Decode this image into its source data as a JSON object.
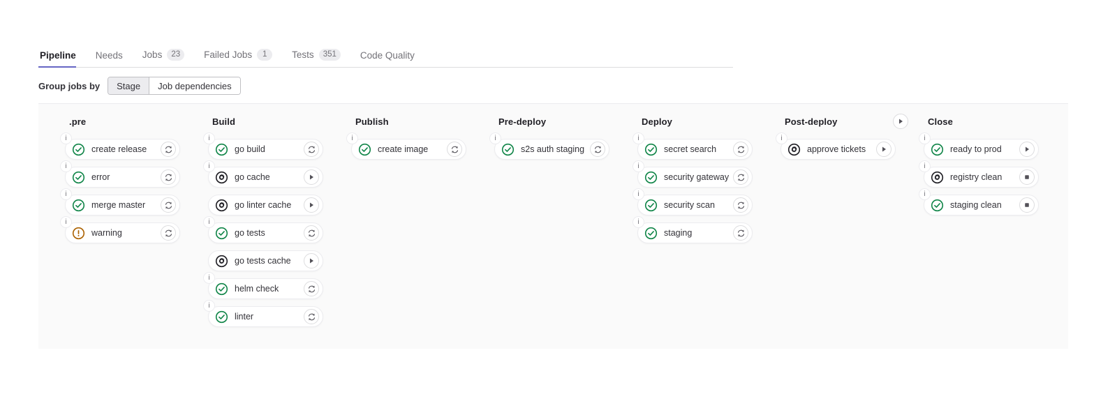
{
  "tabs": [
    {
      "label": "Pipeline",
      "badge": null,
      "active": true
    },
    {
      "label": "Needs",
      "badge": null,
      "active": false
    },
    {
      "label": "Jobs",
      "badge": "23",
      "active": false
    },
    {
      "label": "Failed Jobs",
      "badge": "1",
      "active": false
    },
    {
      "label": "Tests",
      "badge": "351",
      "active": false
    },
    {
      "label": "Code Quality",
      "badge": null,
      "active": false
    }
  ],
  "group_bar": {
    "label": "Group jobs by",
    "options": [
      {
        "label": "Stage",
        "selected": true
      },
      {
        "label": "Job dependencies",
        "selected": false
      }
    ]
  },
  "colors": {
    "accent": "#6666c4",
    "success": "#108548",
    "warning": "#ab6100",
    "manual": "#1f1e24",
    "panel_bg": "#fafafa",
    "card_border": "#ececef",
    "text": "#333238",
    "muted": "#737278"
  },
  "stages": [
    {
      "name": ".pre",
      "header_action": null,
      "jobs": [
        {
          "name": "create release",
          "status": "success",
          "status_icon": "check-circle-icon",
          "action": "retry",
          "action_icon": "retry-icon",
          "info": true
        },
        {
          "name": "error",
          "status": "success",
          "status_icon": "check-circle-icon",
          "action": "retry",
          "action_icon": "retry-icon",
          "info": true
        },
        {
          "name": "merge master",
          "status": "success",
          "status_icon": "check-circle-icon",
          "action": "retry",
          "action_icon": "retry-icon",
          "info": true
        },
        {
          "name": "warning",
          "status": "warning",
          "status_icon": "warning-icon",
          "action": "retry",
          "action_icon": "retry-icon",
          "info": true
        }
      ]
    },
    {
      "name": "Build",
      "header_action": null,
      "jobs": [
        {
          "name": "go build",
          "status": "success",
          "status_icon": "check-circle-icon",
          "action": "retry",
          "action_icon": "retry-icon",
          "info": true
        },
        {
          "name": "go cache",
          "status": "manual",
          "status_icon": "manual-gear-icon",
          "action": "play",
          "action_icon": "play-icon",
          "info": true
        },
        {
          "name": "go linter cache",
          "status": "manual",
          "status_icon": "manual-gear-icon",
          "action": "play",
          "action_icon": "play-icon",
          "info": false
        },
        {
          "name": "go tests",
          "status": "success",
          "status_icon": "check-circle-icon",
          "action": "retry",
          "action_icon": "retry-icon",
          "info": true
        },
        {
          "name": "go tests cache",
          "status": "manual",
          "status_icon": "manual-gear-icon",
          "action": "play",
          "action_icon": "play-icon",
          "info": false
        },
        {
          "name": "helm check",
          "status": "success",
          "status_icon": "check-circle-icon",
          "action": "retry",
          "action_icon": "retry-icon",
          "info": true
        },
        {
          "name": "linter",
          "status": "success",
          "status_icon": "check-circle-icon",
          "action": "retry",
          "action_icon": "retry-icon",
          "info": true
        }
      ]
    },
    {
      "name": "Publish",
      "header_action": null,
      "jobs": [
        {
          "name": "create image",
          "status": "success",
          "status_icon": "check-circle-icon",
          "action": "retry",
          "action_icon": "retry-icon",
          "info": true
        }
      ]
    },
    {
      "name": "Pre-deploy",
      "header_action": null,
      "jobs": [
        {
          "name": "s2s auth staging",
          "status": "success",
          "status_icon": "check-circle-icon",
          "action": "retry",
          "action_icon": "retry-icon",
          "info": true
        }
      ]
    },
    {
      "name": "Deploy",
      "header_action": null,
      "jobs": [
        {
          "name": "secret search",
          "status": "success",
          "status_icon": "check-circle-icon",
          "action": "retry",
          "action_icon": "retry-icon",
          "info": true
        },
        {
          "name": "security gateway",
          "status": "success",
          "status_icon": "check-circle-icon",
          "action": "retry",
          "action_icon": "retry-icon",
          "info": true
        },
        {
          "name": "security scan",
          "status": "success",
          "status_icon": "check-circle-icon",
          "action": "retry",
          "action_icon": "retry-icon",
          "info": true
        },
        {
          "name": "staging",
          "status": "success",
          "status_icon": "check-circle-icon",
          "action": "retry",
          "action_icon": "retry-icon",
          "info": true
        }
      ]
    },
    {
      "name": "Post-deploy",
      "header_action": "play",
      "header_action_icon": "play-icon",
      "jobs": [
        {
          "name": "approve tickets",
          "status": "manual",
          "status_icon": "manual-gear-icon",
          "action": "play",
          "action_icon": "play-icon",
          "info": true
        }
      ]
    },
    {
      "name": "Close",
      "header_action": null,
      "jobs": [
        {
          "name": "ready to prod",
          "status": "success",
          "status_icon": "check-circle-icon",
          "action": "play",
          "action_icon": "play-icon",
          "info": true
        },
        {
          "name": "registry clean",
          "status": "manual",
          "status_icon": "manual-gear-icon",
          "action": "stop",
          "action_icon": "stop-icon",
          "info": true
        },
        {
          "name": "staging clean",
          "status": "success",
          "status_icon": "check-circle-icon",
          "action": "stop",
          "action_icon": "stop-icon",
          "info": true
        }
      ]
    }
  ]
}
